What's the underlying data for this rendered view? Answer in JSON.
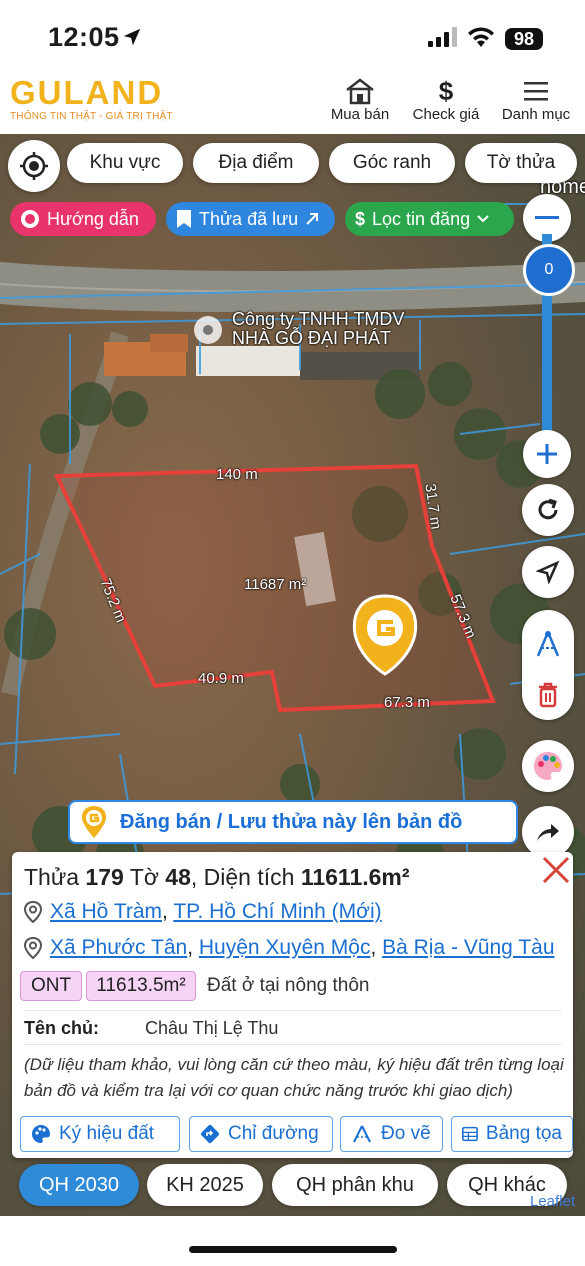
{
  "status_bar": {
    "time": "12:05",
    "battery": "98"
  },
  "header": {
    "logo_text": "GULAND",
    "tagline": "THÔNG TIN THẬT - GIÁ TRỊ THẬT",
    "nav": [
      {
        "label": "Mua bán",
        "icon": "house-icon"
      },
      {
        "label": "Check giá",
        "icon": "dollar-icon"
      },
      {
        "label": "Danh mục",
        "icon": "menu-icon"
      }
    ]
  },
  "filters": {
    "area": "Khu vực",
    "place": "Địa điểm",
    "corner": "Góc ranh",
    "sheet": "Tờ thửa"
  },
  "pills": {
    "guide": "Hướng dẫn",
    "saved": "Thửa đã lưu",
    "filter": "Lọc tin đăng"
  },
  "zoom": {
    "level": "0"
  },
  "map_labels": {
    "poi": "Công ty TNHH TMDV\nNHÀ GỖ ĐẠI PHÁT",
    "top_edge": "140 m",
    "right_top": "31.7 m",
    "left": "75.2 m",
    "right": "57.3 m",
    "bottom_left": "40.9 m",
    "bottom_right": "67.3 m",
    "area": "11687 m²",
    "corner_text": "homest"
  },
  "banner": {
    "label": "Đăng bán / Lưu thửa này lên bản đồ"
  },
  "parcel": {
    "title_prefix": "Thửa ",
    "plot_no": "179",
    "sheet_prefix": " Tờ ",
    "sheet_no": "48",
    "area_prefix": ", Diện tích ",
    "area": "11611.6m²",
    "address1": {
      "commune": "Xã Hồ Tràm",
      "city": "TP. Hồ Chí Minh (Mới)"
    },
    "address2": {
      "commune": "Xã Phước Tân",
      "district": "Huyện Xuyên Mộc",
      "province": "Bà Rịa - Vũng Tàu"
    },
    "land_code": "ONT",
    "land_area": "11613.5m²",
    "land_type": "Đất ở tại nông thôn",
    "owner_label": "Tên chủ:",
    "owner_name": "Châu Thị Lệ Thu",
    "note": "(Dữ liệu tham khảo, vui lòng căn cứ theo màu, ký hiệu đất trên từng loại bản đồ và kiểm tra lại với cơ quan chức năng trước khi giao dịch)"
  },
  "actions": {
    "symbols": "Ký hiệu đất",
    "directions": "Chỉ đường",
    "measure": "Đo vẽ",
    "table": "Bảng tọa"
  },
  "layers": {
    "qh2030": "QH 2030",
    "kh2025": "KH 2025",
    "zone": "QH phân khu",
    "other": "QH khác"
  },
  "attribution": "Leaflet",
  "colors": {
    "accent": "#2f8bd8",
    "brand": "#f2b21c",
    "boundary": "#e6403a",
    "guide": "#e8336b",
    "saved": "#2e86de",
    "filter": "#2ca64d"
  }
}
